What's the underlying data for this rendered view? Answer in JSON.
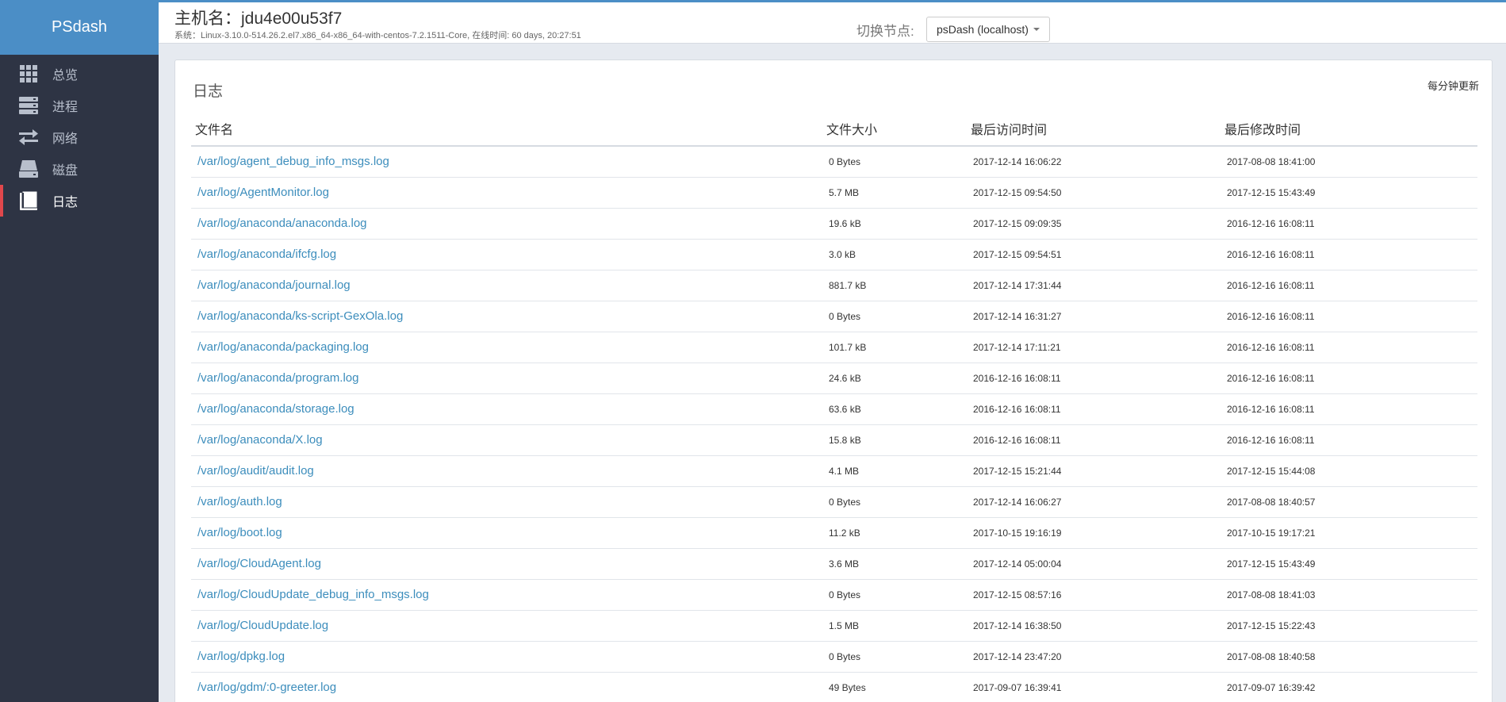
{
  "sidebar": {
    "brand": "PSdash",
    "items": [
      {
        "label": "总览",
        "icon": "grid-icon",
        "active": false
      },
      {
        "label": "进程",
        "icon": "server-stack-icon",
        "active": false
      },
      {
        "label": "网络",
        "icon": "transfer-arrows-icon",
        "active": false
      },
      {
        "label": "磁盘",
        "icon": "hard-drive-icon",
        "active": false
      },
      {
        "label": "日志",
        "icon": "book-icon",
        "active": true
      }
    ]
  },
  "header": {
    "host_title": "主机名：jdu4e00u53f7",
    "system_info": "系统：Linux-3.10.0-514.26.2.el7.x86_64-x86_64-with-centos-7.2.1511-Core, 在线时间: 60 days, 20:27:51",
    "node_label": "切换节点:",
    "node_selected": "psDash (localhost)"
  },
  "panel": {
    "title": "日志",
    "refresh_note": "每分钟更新",
    "columns": [
      "文件名",
      "文件大小",
      "最后访问时间",
      "最后修改时间"
    ],
    "rows": [
      [
        "/var/log/agent_debug_info_msgs.log",
        "0 Bytes",
        "2017-12-14 16:06:22",
        "2017-08-08 18:41:00"
      ],
      [
        "/var/log/AgentMonitor.log",
        "5.7 MB",
        "2017-12-15 09:54:50",
        "2017-12-15 15:43:49"
      ],
      [
        "/var/log/anaconda/anaconda.log",
        "19.6 kB",
        "2017-12-15 09:09:35",
        "2016-12-16 16:08:11"
      ],
      [
        "/var/log/anaconda/ifcfg.log",
        "3.0 kB",
        "2017-12-15 09:54:51",
        "2016-12-16 16:08:11"
      ],
      [
        "/var/log/anaconda/journal.log",
        "881.7 kB",
        "2017-12-14 17:31:44",
        "2016-12-16 16:08:11"
      ],
      [
        "/var/log/anaconda/ks-script-GexOla.log",
        "0 Bytes",
        "2017-12-14 16:31:27",
        "2016-12-16 16:08:11"
      ],
      [
        "/var/log/anaconda/packaging.log",
        "101.7 kB",
        "2017-12-14 17:11:21",
        "2016-12-16 16:08:11"
      ],
      [
        "/var/log/anaconda/program.log",
        "24.6 kB",
        "2016-12-16 16:08:11",
        "2016-12-16 16:08:11"
      ],
      [
        "/var/log/anaconda/storage.log",
        "63.6 kB",
        "2016-12-16 16:08:11",
        "2016-12-16 16:08:11"
      ],
      [
        "/var/log/anaconda/X.log",
        "15.8 kB",
        "2016-12-16 16:08:11",
        "2016-12-16 16:08:11"
      ],
      [
        "/var/log/audit/audit.log",
        "4.1 MB",
        "2017-12-15 15:21:44",
        "2017-12-15 15:44:08"
      ],
      [
        "/var/log/auth.log",
        "0 Bytes",
        "2017-12-14 16:06:27",
        "2017-08-08 18:40:57"
      ],
      [
        "/var/log/boot.log",
        "11.2 kB",
        "2017-10-15 19:16:19",
        "2017-10-15 19:17:21"
      ],
      [
        "/var/log/CloudAgent.log",
        "3.6 MB",
        "2017-12-14 05:00:04",
        "2017-12-15 15:43:49"
      ],
      [
        "/var/log/CloudUpdate_debug_info_msgs.log",
        "0 Bytes",
        "2017-12-15 08:57:16",
        "2017-08-08 18:41:03"
      ],
      [
        "/var/log/CloudUpdate.log",
        "1.5 MB",
        "2017-12-14 16:38:50",
        "2017-12-15 15:22:43"
      ],
      [
        "/var/log/dpkg.log",
        "0 Bytes",
        "2017-12-14 23:47:20",
        "2017-08-08 18:40:58"
      ],
      [
        "/var/log/gdm/:0-greeter.log",
        "49 Bytes",
        "2017-09-07 16:39:41",
        "2017-09-07 16:39:42"
      ]
    ]
  }
}
